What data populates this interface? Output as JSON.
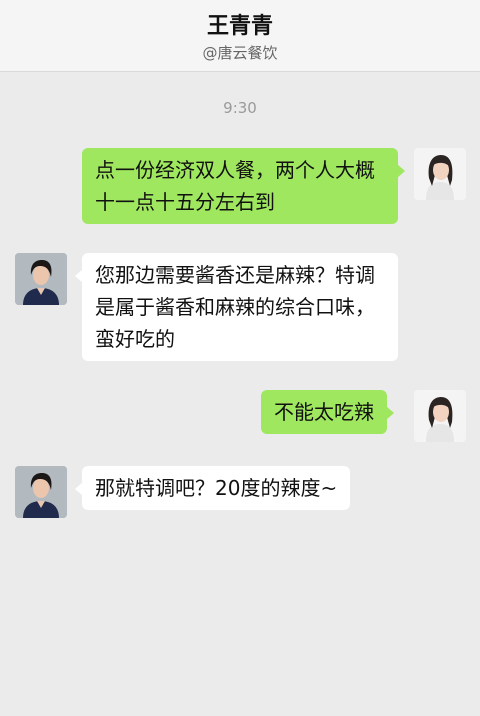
{
  "header": {
    "title": "王青青",
    "subtitle": "@唐云餐饮"
  },
  "timestamp": "9:30",
  "messages": [
    {
      "sender": "self",
      "text": "点一份经济双人餐，两个人大概十一点十五分左右到"
    },
    {
      "sender": "other",
      "text": "您那边需要酱香还是麻辣？特调是属于酱香和麻辣的综合口味，蛮好吃的"
    },
    {
      "sender": "self",
      "text": "不能太吃辣"
    },
    {
      "sender": "other",
      "text": "那就特调吧？20度的辣度~"
    }
  ],
  "colors": {
    "self_bubble": "#9ee75e",
    "other_bubble": "#ffffff",
    "background": "#ebebeb"
  }
}
